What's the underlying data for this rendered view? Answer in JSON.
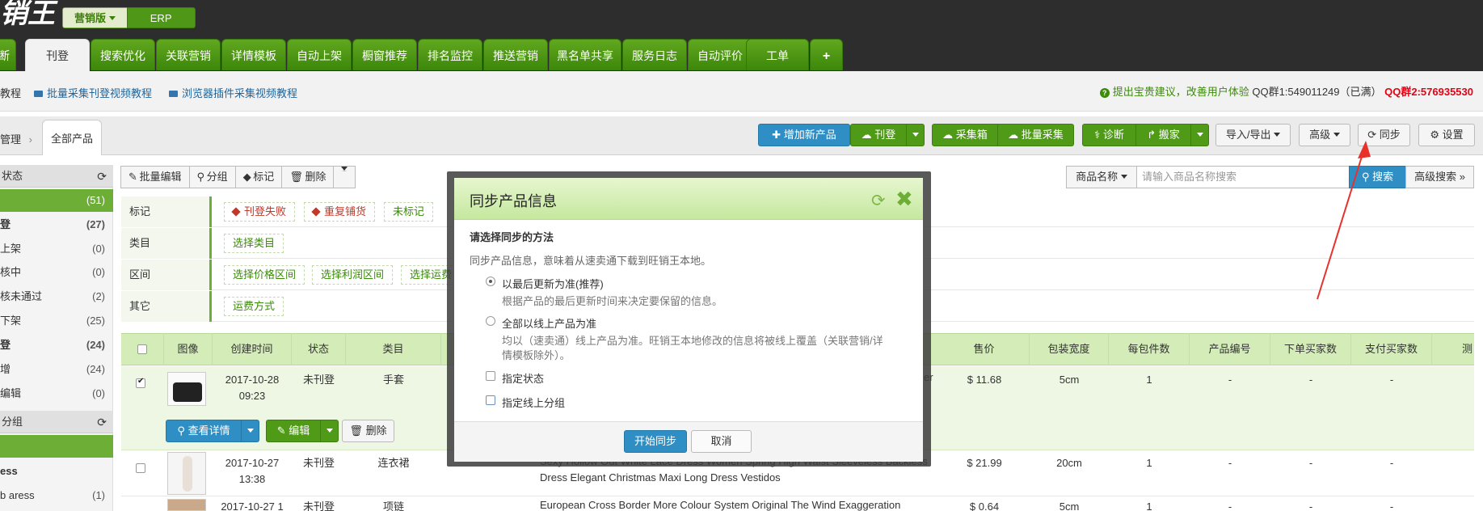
{
  "header": {
    "logo_text": "销王",
    "edition_label": "营销版",
    "erp_label": "ERP"
  },
  "nav_tabs": [
    {
      "label": "断"
    },
    {
      "label": "刊登"
    },
    {
      "label": "搜索优化"
    },
    {
      "label": "关联营销"
    },
    {
      "label": "详情模板"
    },
    {
      "label": "自动上架"
    },
    {
      "label": "橱窗推荐"
    },
    {
      "label": "排名监控"
    },
    {
      "label": "推送营销"
    },
    {
      "label": "黑名单共享"
    },
    {
      "label": "服务日志"
    },
    {
      "label": "自动评价"
    },
    {
      "label": "工单"
    },
    {
      "label": "+"
    }
  ],
  "tutorials": {
    "t0": "教程",
    "t1": "批量采集刊登视频教程",
    "t2": "浏览器插件采集视频教程"
  },
  "qq": {
    "suggest": "提出宝贵建议，改善用户体验",
    "group1": "QQ群1:549011249（已满）",
    "group2": "QQ群2:576935530"
  },
  "breadcrumb": {
    "parent": "管理",
    "current": "全部产品"
  },
  "toolbar": {
    "add": "增加新产品",
    "publish": "刊登",
    "collect_box": "采集箱",
    "batch_collect": "批量采集",
    "diagnose": "诊断",
    "move": "搬家",
    "import_export": "导入/导出",
    "advanced": "高级",
    "sync": "同步",
    "settings": "设置"
  },
  "sidebar": {
    "status_title": "状态",
    "status_items": [
      {
        "label": "",
        "count": "(51)"
      },
      {
        "label": "登",
        "count": "(27)"
      },
      {
        "label": "上架",
        "count": "(0)"
      },
      {
        "label": "核中",
        "count": "(0)"
      },
      {
        "label": "核未通过",
        "count": "(2)"
      },
      {
        "label": "下架",
        "count": "(25)"
      },
      {
        "label": "登",
        "count": "(24)"
      },
      {
        "label": "增",
        "count": "(24)"
      },
      {
        "label": "编辑",
        "count": "(0)"
      }
    ],
    "group_title": "分组",
    "group_items": [
      {
        "label": "",
        "count": ""
      },
      {
        "label": "ess",
        "count": ""
      },
      {
        "label": "b aress",
        "count": "(1)"
      }
    ]
  },
  "bulk": {
    "batch_edit": "批量编辑",
    "group": "分组",
    "mark": "标记",
    "delete": "删除"
  },
  "search": {
    "field": "商品名称",
    "placeholder": "请输入商品名称搜索",
    "button": "搜索",
    "advanced": "高级搜索"
  },
  "filters": {
    "mark_label": "标记",
    "mark_tags": [
      "刊登失败",
      "重复铺货",
      "未标记"
    ],
    "category_label": "类目",
    "category_tag": "选择类目",
    "range_label": "区间",
    "range_tags": [
      "选择价格区间",
      "选择利润区间",
      "选择运费"
    ],
    "other_label": "其它",
    "other_tag": "运费方式"
  },
  "table": {
    "headers": {
      "image": "图像",
      "created": "创建时间",
      "status": "状态",
      "category": "类目",
      "price": "售价",
      "pack_width": "包装宽度",
      "per_pack": "每包件数",
      "product_no": "产品编号",
      "order_buyers": "下单买家数",
      "paid_buyers": "支付买家数",
      "last": "测"
    },
    "rows": [
      {
        "created": "2017-10-28 09:23",
        "status": "未刊登",
        "category": "手套",
        "title": "er",
        "price": "$ 11.68",
        "width": "5cm",
        "count": "1",
        "no": "-",
        "ob": "-",
        "pb": "-"
      },
      {
        "created": "2017-10-27 13:38",
        "status": "未刊登",
        "category": "连衣裙",
        "title": "Sexy Hollow Out White Lace Dress Women Spring High Waist Sleeveless Backless Dress Elegant Christmas Maxi Long Dress Vestidos",
        "price": "$ 21.99",
        "width": "20cm",
        "count": "1",
        "no": "-",
        "ob": "-",
        "pb": "-"
      },
      {
        "created": "2017-10-27 1",
        "status": "未刊登",
        "category": "项链",
        "title": "European Cross Border More Colour System Original The Wind Exaggeration",
        "price": "$ 0.64",
        "width": "5cm",
        "count": "1",
        "no": "-",
        "ob": "-",
        "pb": "-"
      }
    ],
    "row_actions": {
      "view": "查看详情",
      "edit": "编辑",
      "delete": "删除"
    }
  },
  "modal": {
    "title": "同步产品信息",
    "heading": "请选择同步的方法",
    "desc": "同步产品信息，意味着从速卖通下载到旺销王本地。",
    "opt1_label": "以最后更新为准(推荐)",
    "opt1_desc": "根据产品的最后更新时间来决定要保留的信息。",
    "opt2_label": "全部以线上产品为准",
    "opt2_desc1": "均以（速卖通）线上产品为准。旺销王本地修改的信息将被线上覆盖（关联营销/详",
    "opt2_desc2": "情模板除外）。",
    "chk1_label": "指定状态",
    "chk2_label": "指定线上分组",
    "start": "开始同步",
    "cancel": "取消"
  }
}
